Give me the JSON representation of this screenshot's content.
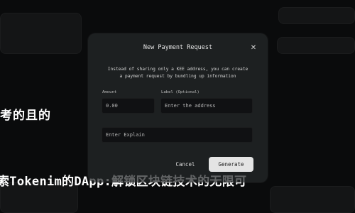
{
  "background": {
    "line1": "考的且的",
    "line2": "索Tokenim的DApp:解锁区块链技术的无限可"
  },
  "modal": {
    "title": "New Payment Request",
    "close_icon": "close-icon",
    "description_line1": "Instead of sharing only a KEE address, you can create",
    "description_line2": "a payment request by bundling up information",
    "amount": {
      "label": "Amount",
      "value": "0.00"
    },
    "label_field": {
      "label": "Label (Optional)",
      "placeholder": "Enter the address"
    },
    "message": {
      "placeholder": "Enter Explain"
    },
    "cancel_label": "Cancel",
    "generate_label": "Generate"
  }
}
